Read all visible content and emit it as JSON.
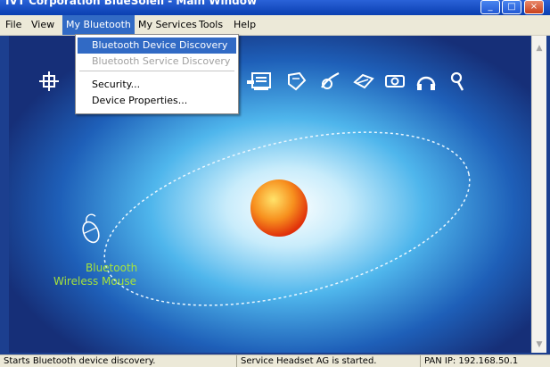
{
  "window": {
    "title": "IVT Corporation BlueSoleil - Main Window"
  },
  "menubar": {
    "items": [
      {
        "label": "File"
      },
      {
        "label": "View"
      },
      {
        "label": "My Bluetooth"
      },
      {
        "label": "My Services"
      },
      {
        "label": "Tools"
      },
      {
        "label": "Help"
      }
    ]
  },
  "dropdown": {
    "discovery": "Bluetooth Device Discovery",
    "service_discovery": "Bluetooth Service Discovery",
    "security": "Security...",
    "properties": "Device Properties..."
  },
  "device": {
    "label_line1": "Bluetooth",
    "label_line2": "Wireless Mouse"
  },
  "service_icons": [
    "network-icon",
    "lan-icon",
    "fax-icon",
    "file-transfer-icon",
    "printer-icon",
    "camera-icon",
    "headset-icon",
    "search-icon"
  ],
  "status": {
    "left": "Starts Bluetooth device discovery.",
    "middle": "Service Headset AG is started.",
    "right": "PAN IP: 192.168.50.1"
  },
  "colors": {
    "background": "#1c3f8f",
    "menu_selected": "#316ac5",
    "device_label": "#a6e33b",
    "orb": "#f25a0e"
  }
}
